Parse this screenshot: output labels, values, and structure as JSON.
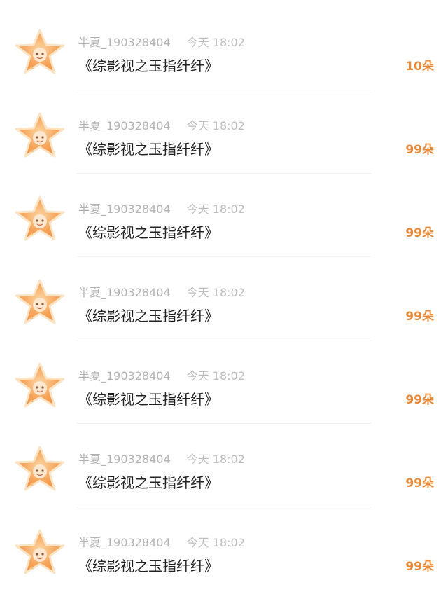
{
  "items": [
    {
      "username": "半夏_190328404",
      "time": "今天 18:02",
      "title": "《综影视之玉指纤纤》",
      "amount": "10朵"
    },
    {
      "username": "半夏_190328404",
      "time": "今天 18:02",
      "title": "《综影视之玉指纤纤》",
      "amount": "99朵"
    },
    {
      "username": "半夏_190328404",
      "time": "今天 18:02",
      "title": "《综影视之玉指纤纤》",
      "amount": "99朵"
    },
    {
      "username": "半夏_190328404",
      "time": "今天 18:02",
      "title": "《综影视之玉指纤纤》",
      "amount": "99朵"
    },
    {
      "username": "半夏_190328404",
      "time": "今天 18:02",
      "title": "《综影视之玉指纤纤》",
      "amount": "99朵"
    },
    {
      "username": "半夏_190328404",
      "time": "今天 18:02",
      "title": "《综影视之玉指纤纤》",
      "amount": "99朵"
    },
    {
      "username": "半夏_190328404",
      "time": "今天 18:02",
      "title": "《综影视之玉指纤纤》",
      "amount": "99朵"
    }
  ],
  "colors": {
    "accent": "#e68a3a",
    "meta": "#b3b3b3",
    "title": "#222222",
    "divider": "#f1f1f1"
  },
  "avatar_icon": "star-avatar-icon"
}
